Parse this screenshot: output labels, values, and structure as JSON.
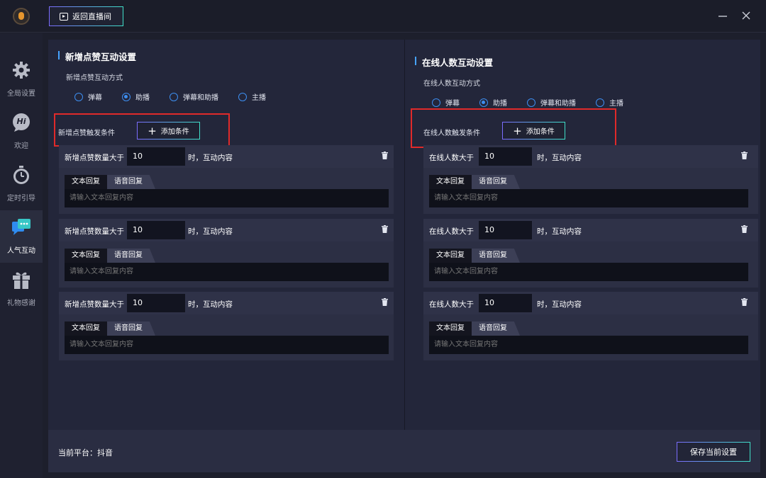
{
  "header": {
    "back_label": "返回直播间"
  },
  "sidebar": {
    "items": [
      {
        "label": "全局设置",
        "icon": "gear-icon"
      },
      {
        "label": "欢迎",
        "icon": "hi-bubble-icon",
        "badge": "Hi"
      },
      {
        "label": "定时引导",
        "icon": "timer-icon"
      },
      {
        "label": "人气互动",
        "icon": "chat-bubbles-icon"
      },
      {
        "label": "礼物感谢",
        "icon": "gift-icon"
      }
    ],
    "active": "人气互动"
  },
  "left_panel": {
    "title": "新增点赞互动设置",
    "mode_label": "新增点赞互动方式",
    "modes": [
      "弹幕",
      "助播",
      "弹幕和助播",
      "主播"
    ],
    "selected_mode": "助播",
    "trigger_label": "新增点赞触发条件",
    "add_label": "添加条件",
    "conditions": [
      {
        "label": "新增点赞数量大于",
        "value": "10",
        "suffix": "时，互动内容",
        "tab_text": "文本回复",
        "tab_voice": "语音回复",
        "placeholder": "请输入文本回复内容"
      },
      {
        "label": "新增点赞数量大于",
        "value": "10",
        "suffix": "时，互动内容",
        "tab_text": "文本回复",
        "tab_voice": "语音回复",
        "placeholder": "请输入文本回复内容"
      },
      {
        "label": "新增点赞数量大于",
        "value": "10",
        "suffix": "时，互动内容",
        "tab_text": "文本回复",
        "tab_voice": "语音回复",
        "placeholder": "请输入文本回复内容"
      }
    ]
  },
  "right_panel": {
    "title": "在线人数互动设置",
    "mode_label": "在线人数互动方式",
    "modes": [
      "弹幕",
      "助播",
      "弹幕和助播",
      "主播"
    ],
    "selected_mode": "助播",
    "trigger_label": "在线人数触发条件",
    "add_label": "添加条件",
    "conditions": [
      {
        "label": "在线人数大于",
        "value": "10",
        "suffix": "时，互动内容",
        "tab_text": "文本回复",
        "tab_voice": "语音回复",
        "placeholder": "请输入文本回复内容"
      },
      {
        "label": "在线人数大于",
        "value": "10",
        "suffix": "时，互动内容",
        "tab_text": "文本回复",
        "tab_voice": "语音回复",
        "placeholder": "请输入文本回复内容"
      },
      {
        "label": "在线人数大于",
        "value": "10",
        "suffix": "时，互动内容",
        "tab_text": "文本回复",
        "tab_voice": "语音回复",
        "placeholder": "请输入文本回复内容"
      }
    ]
  },
  "footer": {
    "platform": "当前平台：抖音",
    "save_label": "保存当前设置"
  },
  "colors": {
    "accent_blue": "#3d8ef0",
    "highlight_red": "#e02a2a",
    "gradient_start": "#7b6cff",
    "gradient_end": "#3fe0c8"
  }
}
